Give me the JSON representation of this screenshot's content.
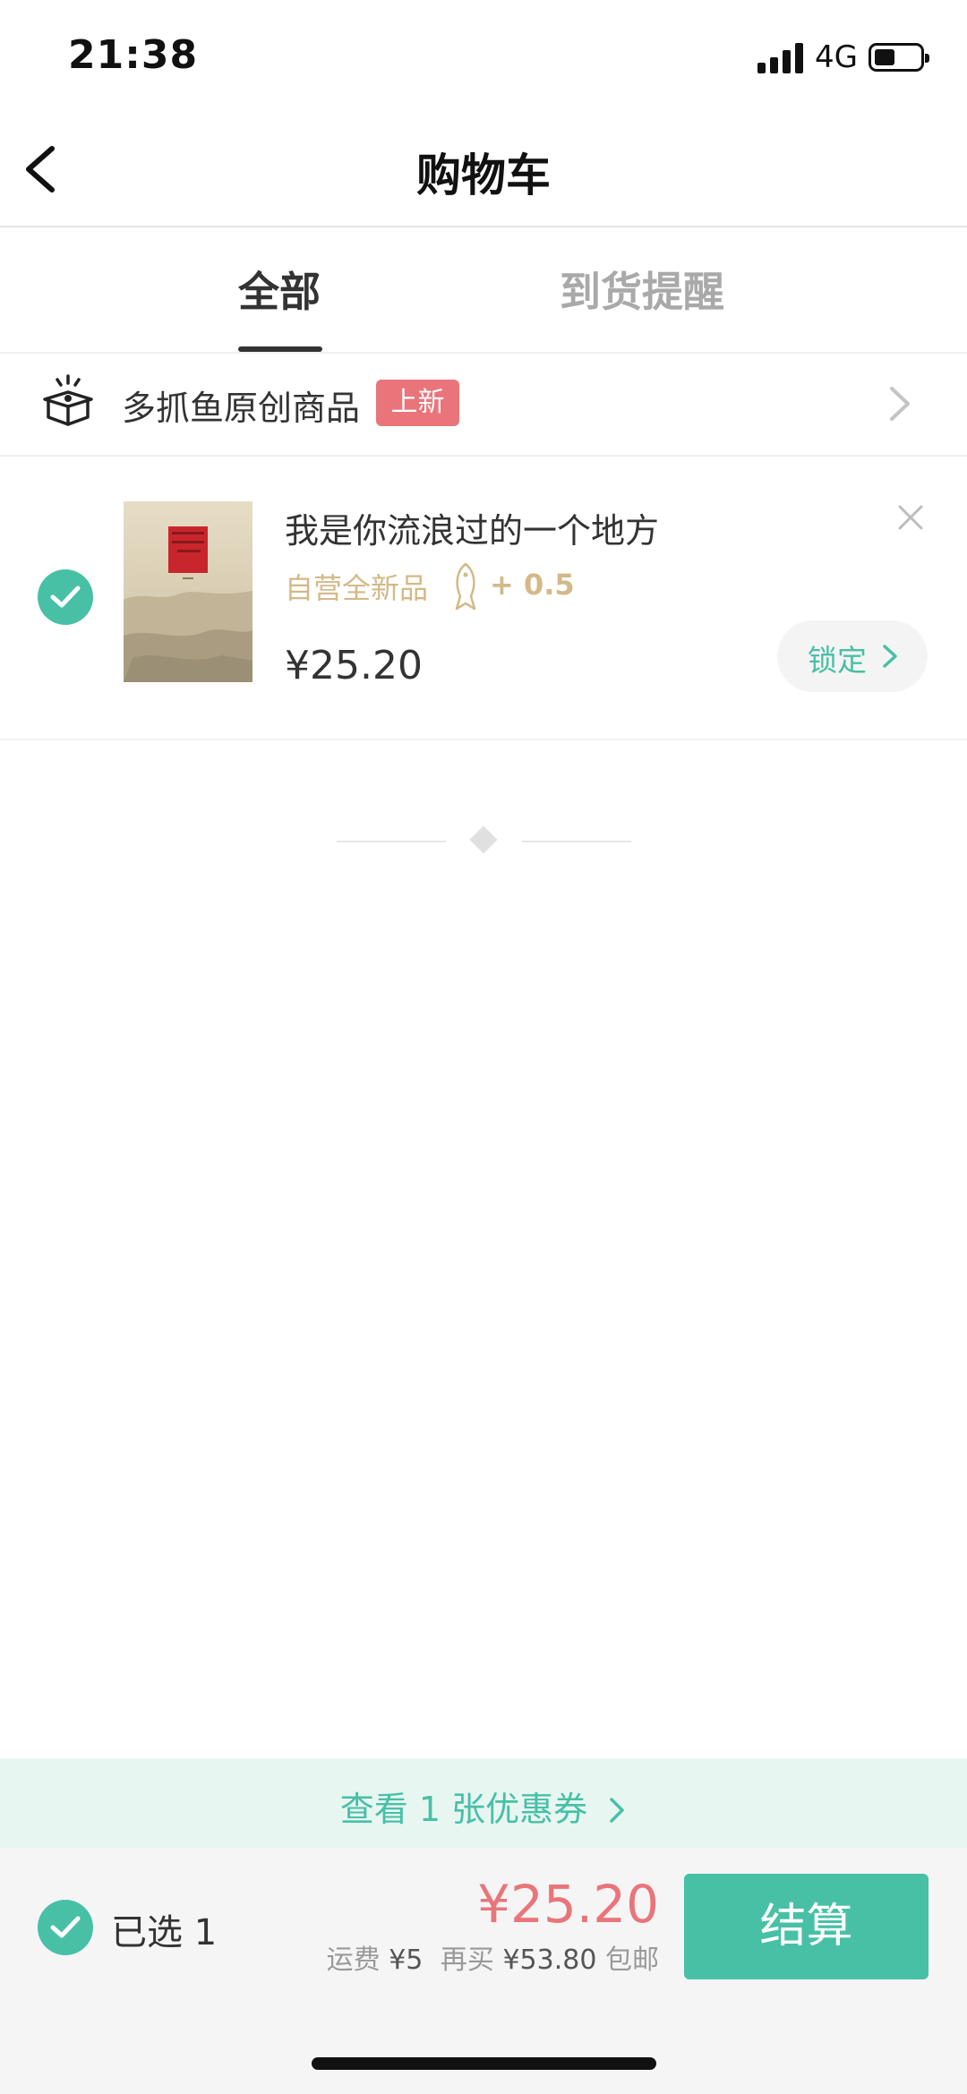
{
  "status_bar": {
    "time": "21:38",
    "network": "4G",
    "battery_level": 0.45
  },
  "header": {
    "title": "购物车"
  },
  "tabs": [
    {
      "label": "全部",
      "active": true
    },
    {
      "label": "到货提醒",
      "active": false
    }
  ],
  "shop": {
    "name": "多抓鱼原创商品",
    "badge": "上新"
  },
  "cart_items": [
    {
      "selected": true,
      "title": "我是你流浪过的一个地方",
      "tag": "自营全新品",
      "bonus": "+ 0.5",
      "price": "¥25.20",
      "action_label": "锁定"
    }
  ],
  "coupon": {
    "label": "查看 1 张优惠券"
  },
  "bottom": {
    "selected_label": "已选 1",
    "total": "¥25.20",
    "shipping_label": "运费",
    "shipping_value": "¥5",
    "more_label": "再买",
    "more_value": "¥53.80",
    "free_label": "包邮",
    "checkout_label": "结算"
  },
  "colors": {
    "accent": "#47c0a6",
    "price_red": "#e9757a",
    "gold": "#d3b988"
  }
}
